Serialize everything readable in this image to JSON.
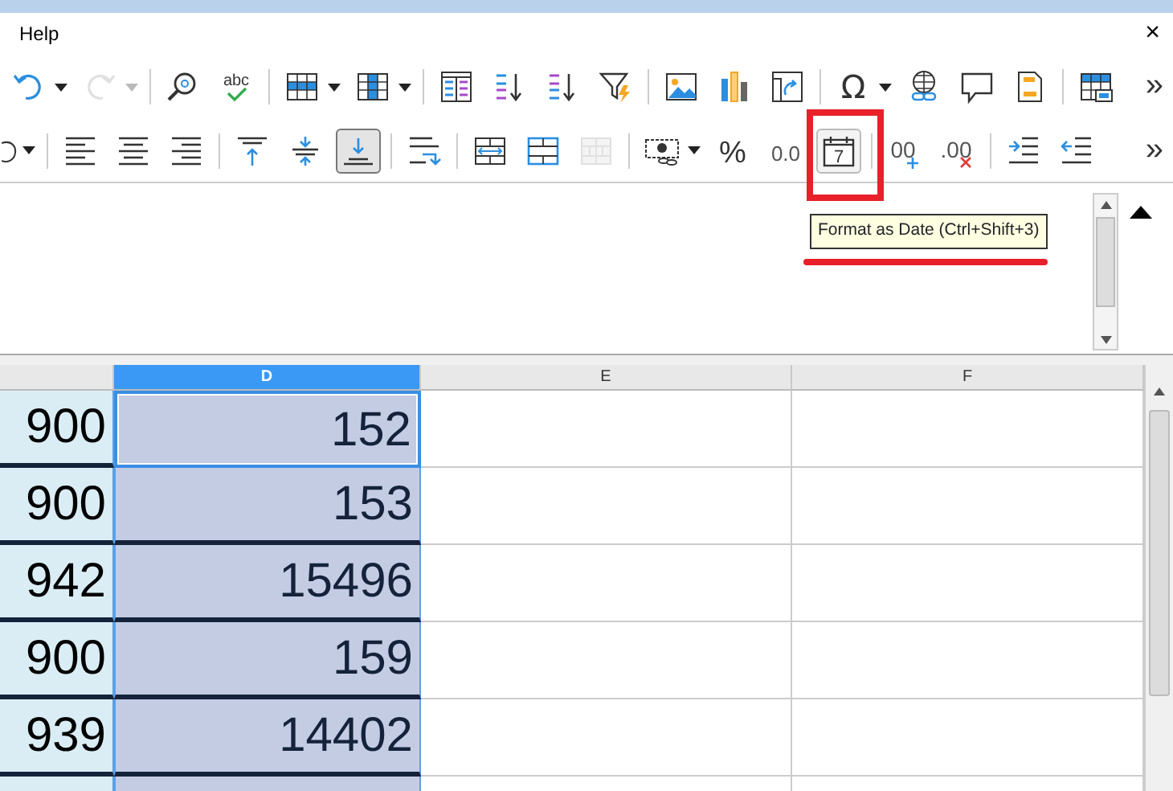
{
  "menu": {
    "items": [
      "Help"
    ],
    "close": "×"
  },
  "toolbar_1": [
    {
      "buttons": [
        {
          "kind": "undo",
          "menu": true,
          "disabled": false
        },
        {
          "kind": "redo",
          "menu": true,
          "disabled": true
        }
      ]
    },
    {
      "buttons": [
        {
          "kind": "find",
          "disabled": false
        },
        {
          "kind": "spell",
          "glyph": "abc",
          "disabled": false
        }
      ]
    },
    {
      "buttons": [
        {
          "kind": "rows",
          "menu": true,
          "disabled": false
        },
        {
          "kind": "columns",
          "menu": true,
          "disabled": false
        }
      ]
    },
    {
      "buttons": [
        {
          "kind": "sort",
          "disabled": false
        },
        {
          "kind": "sort_asc",
          "disabled": false
        },
        {
          "kind": "sort_desc",
          "disabled": false
        },
        {
          "kind": "autofilter",
          "disabled": false
        }
      ]
    },
    {
      "buttons": [
        {
          "kind": "image",
          "disabled": false
        },
        {
          "kind": "chart",
          "disabled": false
        },
        {
          "kind": "pivot",
          "disabled": false
        }
      ]
    },
    {
      "buttons": [
        {
          "kind": "special",
          "glyph": "Ω",
          "menu": true,
          "disabled": false
        },
        {
          "kind": "hyperlink",
          "disabled": false
        },
        {
          "kind": "comment",
          "disabled": false
        },
        {
          "kind": "headerfooter",
          "disabled": false
        }
      ]
    },
    {
      "buttons": [
        {
          "kind": "printarea",
          "disabled": false
        }
      ]
    }
  ],
  "toolbar_1_more": "»",
  "toolbar_2": [
    {
      "buttons": [
        {
          "kind": "clone",
          "menu": true,
          "disabled": false,
          "selected": false,
          "hovered": false
        }
      ]
    },
    {
      "buttons": [
        {
          "kind": "align_left",
          "disabled": false,
          "selected": false,
          "hovered": false
        },
        {
          "kind": "align_center",
          "disabled": false,
          "selected": false,
          "hovered": false
        },
        {
          "kind": "align_right",
          "disabled": false,
          "selected": false,
          "hovered": false
        }
      ]
    },
    {
      "buttons": [
        {
          "kind": "valign_top",
          "disabled": false,
          "selected": false,
          "hovered": false
        },
        {
          "kind": "valign_center",
          "disabled": false,
          "selected": false,
          "hovered": false
        },
        {
          "kind": "valign_bottom",
          "disabled": false,
          "selected": true,
          "hovered": false
        }
      ]
    },
    {
      "buttons": [
        {
          "kind": "wrap",
          "disabled": false,
          "selected": false,
          "hovered": false
        }
      ]
    },
    {
      "buttons": [
        {
          "kind": "merge_center",
          "disabled": false,
          "selected": false,
          "hovered": false
        },
        {
          "kind": "merge",
          "disabled": false,
          "selected": false,
          "hovered": false
        },
        {
          "kind": "unmerge",
          "disabled": true,
          "selected": false,
          "hovered": false
        }
      ]
    },
    {
      "buttons": [
        {
          "kind": "currency",
          "menu": true,
          "disabled": false,
          "selected": false,
          "hovered": false
        },
        {
          "kind": "percent",
          "glyph": "%",
          "disabled": false,
          "selected": false,
          "hovered": false
        },
        {
          "kind": "number",
          "glyph": "0.0",
          "disabled": false,
          "selected": false,
          "hovered": false
        },
        {
          "kind": "date",
          "glyph": "7",
          "disabled": false,
          "selected": false,
          "hovered": true
        }
      ]
    },
    {
      "buttons": [
        {
          "kind": "add_decimal",
          "glyph": "00",
          "disabled": false,
          "selected": false,
          "hovered": false
        },
        {
          "kind": "del_decimal",
          "glyph": ".00",
          "disabled": false,
          "selected": false,
          "hovered": false
        }
      ]
    },
    {
      "buttons": [
        {
          "kind": "indent_inc",
          "disabled": false,
          "selected": false,
          "hovered": false
        },
        {
          "kind": "indent_dec",
          "disabled": false,
          "selected": false,
          "hovered": false
        }
      ]
    }
  ],
  "toolbar_2_more": "»",
  "tooltip": "Format as Date (Ctrl+Shift+3)",
  "sheet": {
    "columns": [
      {
        "label": "D",
        "selected": true
      },
      {
        "label": "E",
        "selected": false
      },
      {
        "label": "F",
        "selected": false
      }
    ],
    "rows": [
      {
        "column_1": "900",
        "cells": [
          "152",
          "",
          ""
        ],
        "active": true
      },
      {
        "column_1": "900",
        "cells": [
          "153",
          "",
          ""
        ],
        "active": false
      },
      {
        "column_1": "942",
        "cells": [
          "15496",
          "",
          ""
        ],
        "active": false
      },
      {
        "column_1": "900",
        "cells": [
          "159",
          "",
          ""
        ],
        "active": false
      },
      {
        "column_1": "939",
        "cells": [
          "14402",
          "",
          ""
        ],
        "active": false
      }
    ]
  }
}
